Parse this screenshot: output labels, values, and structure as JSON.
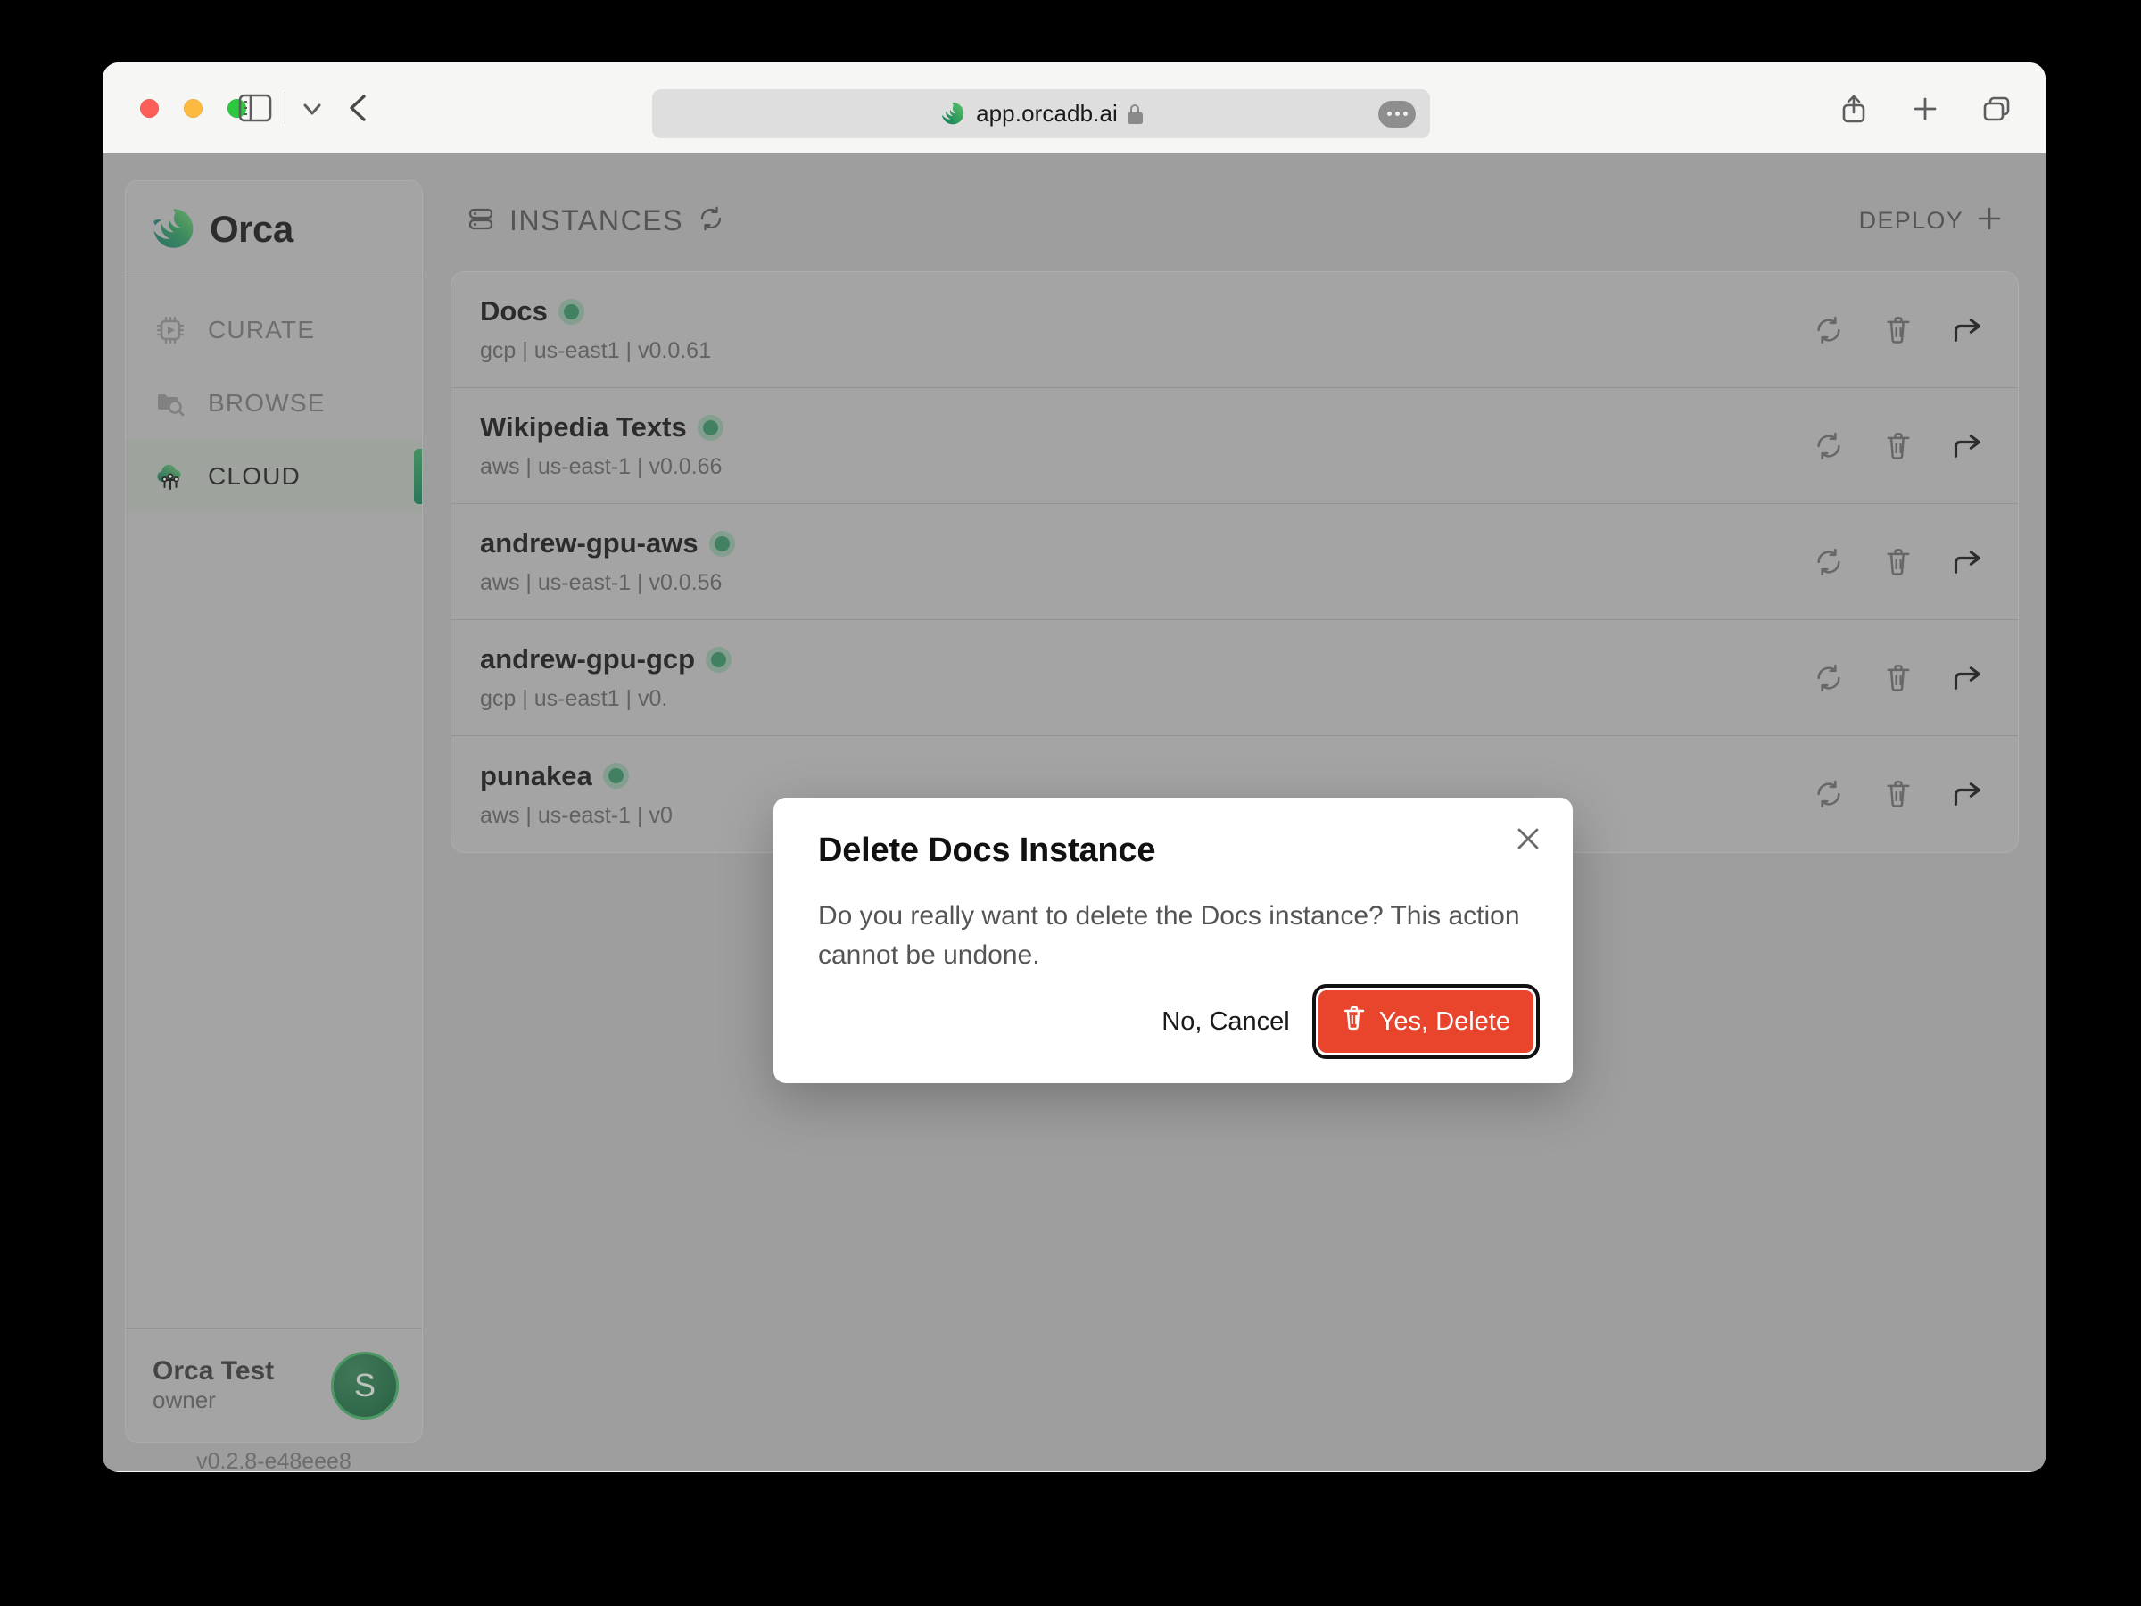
{
  "browser": {
    "url": "app.orcadb.ai",
    "lock_icon": "lock-icon",
    "back_icon": "back-chevron-icon",
    "sidebar_toggle_icon": "sidebar-toggle-icon",
    "dropdown_icon": "chevron-down-icon",
    "more_icon": "more-options-icon",
    "share_icon": "share-icon",
    "new_tab_icon": "plus-icon",
    "tabs_icon": "tab-overview-icon"
  },
  "sidebar": {
    "brand": "Orca",
    "brand_icon": "orca-logo-icon",
    "items": [
      {
        "label": "CURATE",
        "icon": "chip-play-icon",
        "active": false
      },
      {
        "label": "BROWSE",
        "icon": "folder-search-icon",
        "active": false
      },
      {
        "label": "CLOUD",
        "icon": "cloud-network-icon",
        "active": true
      }
    ],
    "user": {
      "name": "Orca Test",
      "role": "owner",
      "avatar_initial": "S"
    },
    "version": "v0.2.8-e48eee8"
  },
  "main": {
    "title": "INSTANCES",
    "title_icon": "server-icon",
    "refresh_icon": "refresh-icon",
    "deploy_label": "DEPLOY",
    "deploy_icon": "plus-icon",
    "row_actions": {
      "restart_icon": "refresh-icon",
      "delete_icon": "trash-icon",
      "open_icon": "share-arrow-icon"
    },
    "instances": [
      {
        "name": "Docs",
        "provider": "gcp",
        "region": "us-east1",
        "version": "v0.0.61",
        "meta": "gcp | us-east1 | v0.0.61",
        "status": "online"
      },
      {
        "name": "Wikipedia Texts",
        "provider": "aws",
        "region": "us-east-1",
        "version": "v0.0.66",
        "meta": "aws | us-east-1 | v0.0.66",
        "status": "online"
      },
      {
        "name": "andrew-gpu-aws",
        "provider": "aws",
        "region": "us-east-1",
        "version": "v0.0.56",
        "meta": "aws | us-east-1 | v0.0.56",
        "status": "online"
      },
      {
        "name": "andrew-gpu-gcp",
        "provider": "gcp",
        "region": "us-east1",
        "version": "v0.",
        "meta": "gcp | us-east1 | v0.",
        "status": "online"
      },
      {
        "name": "punakea",
        "provider": "aws",
        "region": "us-east-1",
        "version": "v0",
        "meta": "aws | us-east-1 | v0",
        "status": "online"
      }
    ]
  },
  "modal": {
    "title": "Delete Docs Instance",
    "body": "Do you really want to delete the Docs instance? This action cannot be undone.",
    "cancel_label": "No, Cancel",
    "confirm_label": "Yes, Delete",
    "confirm_icon": "trash-icon",
    "close_icon": "close-icon",
    "confirm_color": "#e8452c"
  }
}
